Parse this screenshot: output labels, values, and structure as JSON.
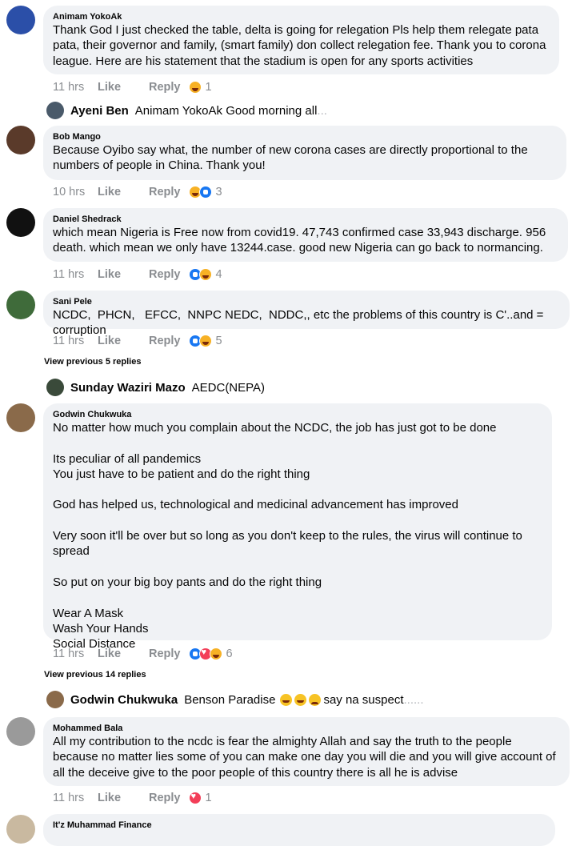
{
  "comments": [
    {
      "author": "Animam YokoAk",
      "text": "Thank God I just checked the table, delta is going for relegation Pls help them relegate pata pata, their governor and family, (smart family) don collect relegation fee. Thank you to corona league. Here are his statement that the stadium is open for any sports activities",
      "time": "11 hrs",
      "like": "Like",
      "reply": "Reply",
      "reaction_count": "1",
      "avatar_color": "#2b4fa8"
    },
    {
      "author": "Bob Mango",
      "text": "Because Oyibo say what, the number of new corona cases are directly proportional to the numbers of people in China. Thank you!",
      "time": "10 hrs",
      "like": "Like",
      "reply": "Reply",
      "reaction_count": "3",
      "avatar_color": "#5a3a2a"
    },
    {
      "author": "Daniel Shedrack",
      "text": "which mean Nigeria is Free now from covid19. 47,743 confirmed case 33,943 discharge. 956 death. which mean we only have 13244.case. good new Nigeria can go back to normancing.",
      "time": "11 hrs",
      "like": "Like",
      "reply": "Reply",
      "reaction_count": "4",
      "avatar_color": "#111111"
    },
    {
      "author": "Sani Pele",
      "text": "NCDC,  PHCN,   EFCC,  NNPC NEDC,  NDDC,, etc the problems of this country is C'..and = corruption",
      "time": "11 hrs",
      "like": "Like",
      "reply": "Reply",
      "reaction_count": "5",
      "avatar_color": "#3f6b3a"
    },
    {
      "author": "Godwin Chukwuka",
      "text": "No matter how much you complain about the NCDC, the job has just got to be done\n\nIts peculiar of all pandemics\nYou just have to be patient and do the right thing\n\nGod has helped us, technological and medicinal advancement has improved\n\nVery soon it'll be over but so long as you don't keep to the rules, the virus will continue to spread\n\nSo put on your big boy pants and do the right thing\n\nWear A Mask\nWash Your Hands\nSocial Distance",
      "time": "11 hrs",
      "like": "Like",
      "reply": "Reply",
      "reaction_count": "6",
      "avatar_color": "#8a6a4a"
    },
    {
      "author": "Mohammed Bala",
      "text": "All my contribution to the ncdc is fear the almighty Allah and say the truth to the people because no matter lies some of you can make one day you will die and you will give account of all the deceive give to the poor people of this country there is all he is advise",
      "time": "11 hrs",
      "like": "Like",
      "reply": "Reply",
      "reaction_count": "1",
      "avatar_color": "#9a9a9a"
    },
    {
      "author": "It'z Muhammad Finance",
      "avatar_color": "#c9b9a0"
    }
  ],
  "replies": [
    {
      "name": "Ayeni Ben",
      "text": "Animam YokoAk Good morning all",
      "dots": "...",
      "avatar_color": "#4a5a6a"
    },
    {
      "name": "Sunday Waziri Mazo",
      "text": "AEDC(NEPA)",
      "avatar_color": "#3a4a3a"
    },
    {
      "name": "Godwin Chukwuka",
      "text": "Benson Paradise",
      "text2": "say na suspect",
      "dots": "......",
      "avatar_color": "#8a6a4a"
    }
  ],
  "view_previous": [
    "View previous 5 replies",
    "View previous 14 replies"
  ]
}
